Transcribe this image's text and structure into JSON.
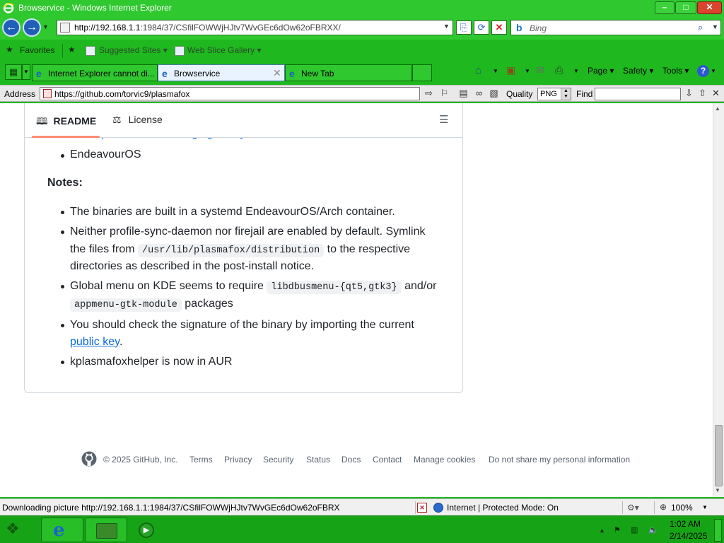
{
  "window": {
    "title": "Browservice - Windows Internet Explorer",
    "controls": {
      "minimize": "–",
      "maximize": "□",
      "close": "✕"
    }
  },
  "navbar": {
    "address_host": "http://192.168.1.1",
    "address_rest": ":1984/37/CSfilFOWWjHJtv7WvGEc6dOw62oFBRXX/",
    "search_placeholder": "Bing"
  },
  "favorites": {
    "label": "Favorites",
    "suggested": "Suggested Sites ▾",
    "web_slice": "Web Slice Gallery ▾"
  },
  "tabs": [
    {
      "label": "Internet Explorer cannot di..."
    },
    {
      "label": "Browservice"
    },
    {
      "label": "New Tab"
    }
  ],
  "command_bar": {
    "page": "Page ▾",
    "safety": "Safety ▾",
    "tools": "Tools ▾",
    "help": "?"
  },
  "address_toolbar": {
    "label": "Address",
    "url": "https://github.com/torvic9/plasmafox",
    "quality_label": "Quality",
    "quality_value": "PNG",
    "find_label": "Find"
  },
  "readme": {
    "tab_readme": "README",
    "tab_license": "License",
    "cut_link": "openSUSE / Packaging Filesystem",
    "endeavour_link": "EndeavourOS",
    "notes_heading": "Notes:",
    "notes": {
      "n1": "The binaries are built in a systemd EndeavourOS/Arch container.",
      "n2a": "Neither profile-sync-daemon nor firejail are enabled by default. Symlink",
      "n2b": "the files from",
      "n2code": "/usr/lib/plasmafox/distribution",
      "n2c": "to the respective",
      "n2d": "directories as described in the post-install notice.",
      "n3a": "Global menu on KDE seems to require",
      "n3code1": "libdbusmenu-{qt5,gtk3}",
      "n3b": "and/or",
      "n3code2": "appmenu-gtk-module",
      "n3c": "packages",
      "n4a": "You should check the signature of the binary by importing the current",
      "n4link": "public key",
      "n4end": ".",
      "n5": "kplasmafoxhelper is now in AUR"
    }
  },
  "footer": {
    "copyright": "© 2025 GitHub, Inc.",
    "links": [
      "Terms",
      "Privacy",
      "Security",
      "Status",
      "Docs",
      "Contact",
      "Manage cookies",
      "Do not share my personal information"
    ]
  },
  "statusbar": {
    "text": "Downloading picture http://192.168.1.1:1984/37/CSfilFOWWjHJtv7WvGEc6dOw62oFBRX",
    "zone": "Internet | Protected Mode: On",
    "zoom": "100%"
  },
  "taskbar": {
    "time": "1:02 AM",
    "date": "2/14/2025"
  },
  "colors": {
    "chrome_green": "#2fc82f",
    "link_blue": "#0969da",
    "readme_underline": "#fd8c73"
  }
}
